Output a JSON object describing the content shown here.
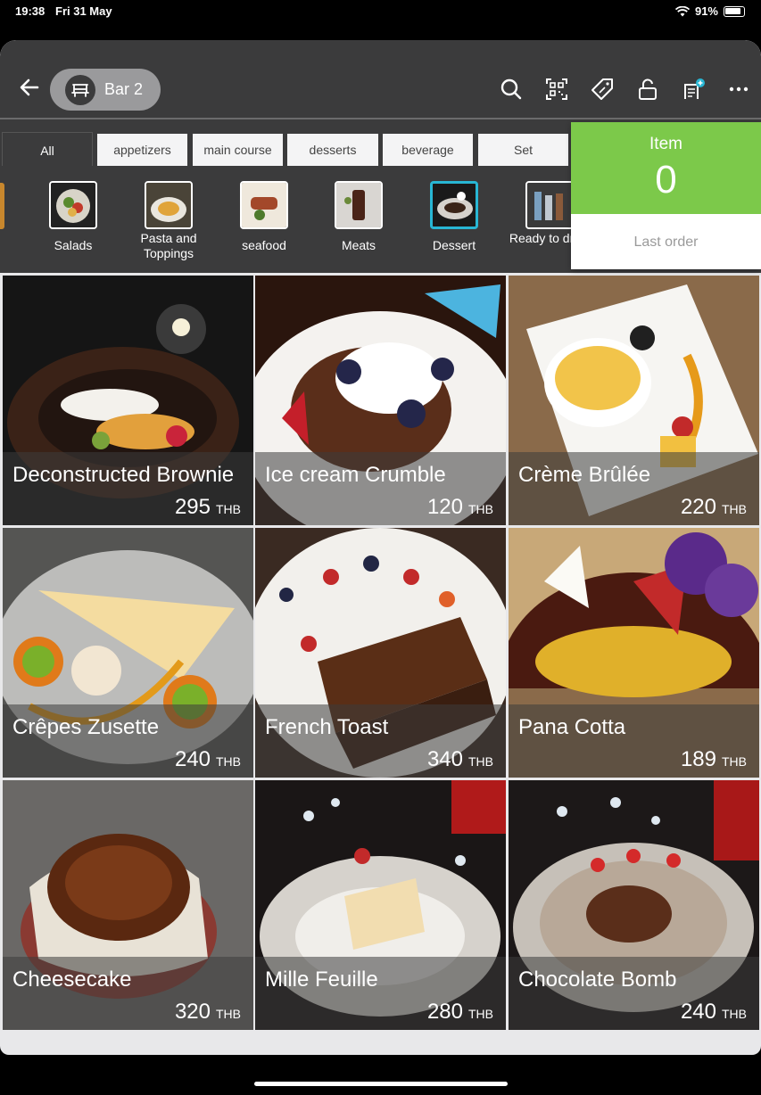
{
  "status": {
    "time": "19:38",
    "date": "Fri 31 May",
    "battery": "91%"
  },
  "header": {
    "table_label": "Bar 2",
    "icons": [
      "search-icon",
      "qr-scan-icon",
      "discount-tag-icon",
      "unlock-icon",
      "add-order-icon",
      "more-icon"
    ]
  },
  "tabs": [
    {
      "label": "All",
      "active": true
    },
    {
      "label": "appetizers"
    },
    {
      "label": "main course"
    },
    {
      "label": "desserts"
    },
    {
      "label": "beverage"
    },
    {
      "label": "Set"
    }
  ],
  "subcategories": [
    {
      "label": "Salads"
    },
    {
      "label": "Pasta and Toppings"
    },
    {
      "label": "seafood"
    },
    {
      "label": "Meats"
    },
    {
      "label": "Dessert",
      "active": true
    },
    {
      "label": "Ready to drink"
    }
  ],
  "order": {
    "title": "Item",
    "count": "0",
    "last": "Last order"
  },
  "colors": {
    "bar": "#3b3b3c",
    "accent_green": "#7cc94a",
    "selected": "#28b6d4"
  },
  "items": [
    {
      "name": "Deconstructed Brownie",
      "price": "295",
      "currency": "THB"
    },
    {
      "name": "Ice cream Crumble",
      "price": "120",
      "currency": "THB"
    },
    {
      "name": "Crème Brûlée",
      "price": "220",
      "currency": "THB"
    },
    {
      "name": "Crêpes Zusette",
      "price": "240",
      "currency": "THB"
    },
    {
      "name": "French Toast",
      "price": "340",
      "currency": "THB"
    },
    {
      "name": "Pana Cotta",
      "price": "189",
      "currency": "THB"
    },
    {
      "name": "Cheesecake",
      "price": "320",
      "currency": "THB"
    },
    {
      "name": "Mille Feuille",
      "price": "280",
      "currency": "THB"
    },
    {
      "name": "Chocolate Bomb",
      "price": "240",
      "currency": "THB"
    }
  ]
}
